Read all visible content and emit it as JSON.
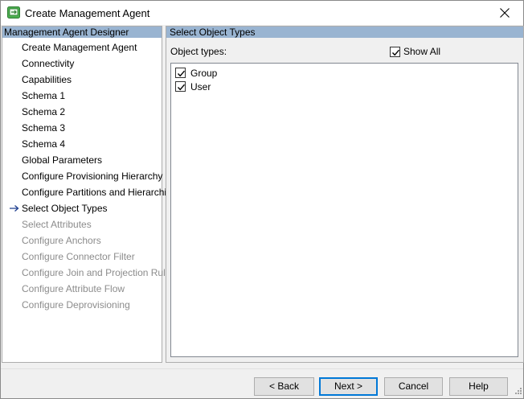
{
  "window": {
    "title": "Create Management Agent"
  },
  "designer": {
    "header": "Management Agent Designer",
    "items": [
      {
        "label": "Create Management Agent",
        "state": "done"
      },
      {
        "label": "Connectivity",
        "state": "done"
      },
      {
        "label": "Capabilities",
        "state": "done"
      },
      {
        "label": "Schema 1",
        "state": "done"
      },
      {
        "label": "Schema 2",
        "state": "done"
      },
      {
        "label": "Schema 3",
        "state": "done"
      },
      {
        "label": "Schema 4",
        "state": "done"
      },
      {
        "label": "Global Parameters",
        "state": "done"
      },
      {
        "label": "Configure Provisioning Hierarchy",
        "state": "done"
      },
      {
        "label": "Configure Partitions and Hierarchies",
        "state": "done"
      },
      {
        "label": "Select Object Types",
        "state": "current"
      },
      {
        "label": "Select Attributes",
        "state": "disabled"
      },
      {
        "label": "Configure Anchors",
        "state": "disabled"
      },
      {
        "label": "Configure Connector Filter",
        "state": "disabled"
      },
      {
        "label": "Configure Join and Projection Rules",
        "state": "disabled"
      },
      {
        "label": "Configure Attribute Flow",
        "state": "disabled"
      },
      {
        "label": "Configure Deprovisioning",
        "state": "disabled"
      }
    ]
  },
  "main": {
    "header": "Select Object Types",
    "object_types_label": "Object types:",
    "show_all": {
      "label": "Show All",
      "checked": true
    },
    "object_types": [
      {
        "label": "Group",
        "checked": true
      },
      {
        "label": "User",
        "checked": true
      }
    ]
  },
  "buttons": {
    "back": "< Back",
    "next": "Next >",
    "cancel": "Cancel",
    "help": "Help"
  },
  "colors": {
    "header_bg": "#99b4d1",
    "accent": "#0078d7",
    "disabled_text": "#8c8c8c",
    "arrow": "#1f3f8f"
  }
}
